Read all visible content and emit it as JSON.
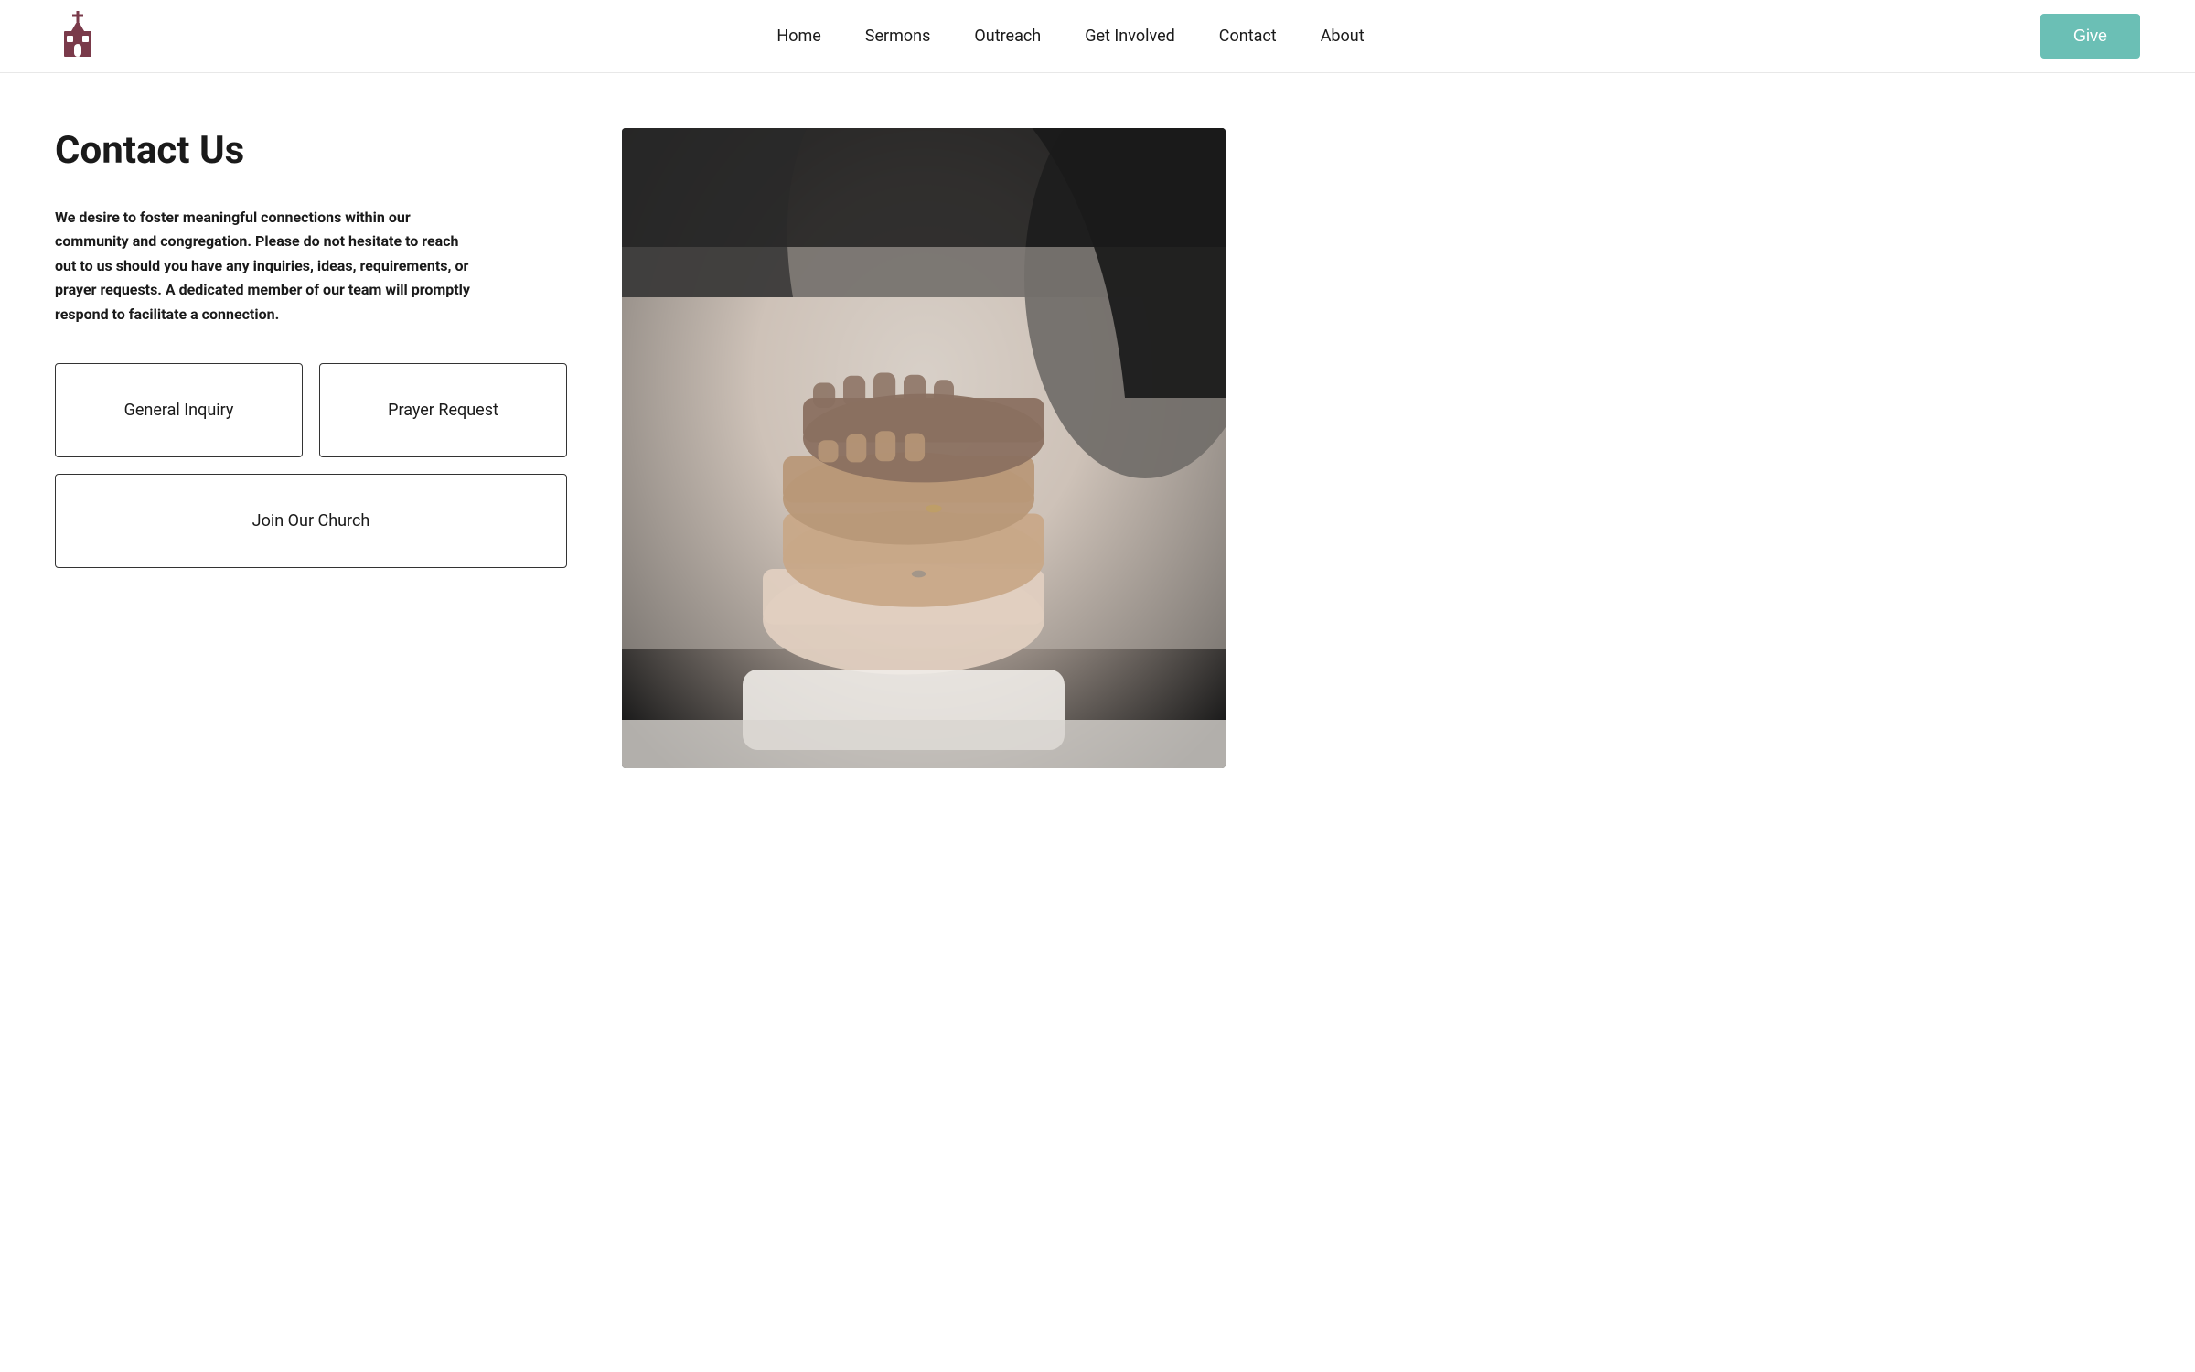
{
  "nav": {
    "logo_alt": "Church Logo",
    "links": [
      {
        "label": "Home",
        "href": "#"
      },
      {
        "label": "Sermons",
        "href": "#"
      },
      {
        "label": "Outreach",
        "href": "#"
      },
      {
        "label": "Get Involved",
        "href": "#"
      },
      {
        "label": "Contact",
        "href": "#"
      },
      {
        "label": "About",
        "href": "#"
      }
    ],
    "give_label": "Give"
  },
  "main": {
    "page_title": "Contact Us",
    "description": "We desire to foster meaningful connections within our community and congregation. Please do not hesitate to reach out to us should you have any inquiries, ideas, requirements, or prayer requests. A dedicated member of our team will promptly respond to facilitate a connection.",
    "cards": [
      {
        "id": "general-inquiry",
        "label": "General Inquiry"
      },
      {
        "id": "prayer-request",
        "label": "Prayer Request"
      },
      {
        "id": "join-church",
        "label": "Join Our Church"
      }
    ]
  }
}
